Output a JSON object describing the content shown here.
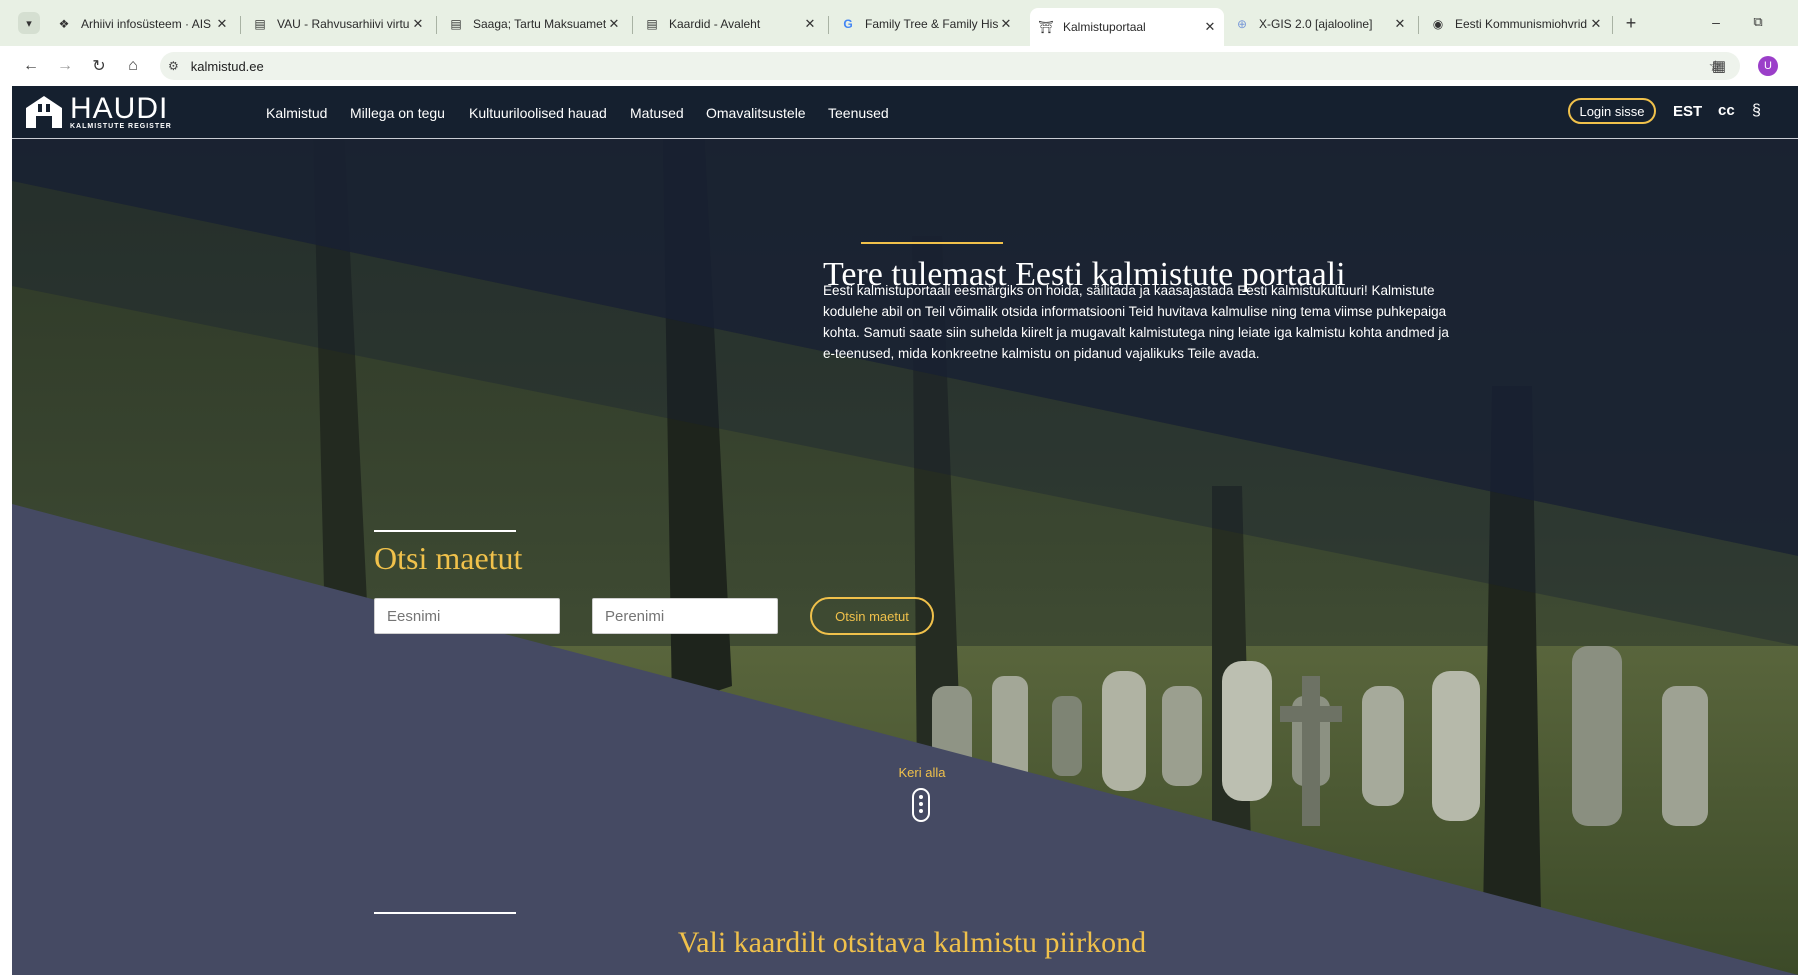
{
  "browser": {
    "tabs": [
      {
        "title": "Arhiivi infosüsteem · AIS",
        "icon": "ais-icon"
      },
      {
        "title": "VAU - Rahvusarhiivi virtua",
        "icon": "document-icon"
      },
      {
        "title": "Saaga; Tartu Maksuamet",
        "icon": "document-icon"
      },
      {
        "title": "Kaardid - Avaleht",
        "icon": "document-icon"
      },
      {
        "title": "Family Tree & Family Hist",
        "icon": "google-icon"
      },
      {
        "title": "Kalmistuportaal",
        "icon": "haudi-icon"
      },
      {
        "title": "X-GIS 2.0 [ajalooline]",
        "icon": "globe-icon"
      },
      {
        "title": "Eesti Kommunismiohvrid",
        "icon": "globe-icon"
      }
    ],
    "url": "kalmistud.ee",
    "profile_initial": "U"
  },
  "site": {
    "logo_text": "HAUDI",
    "logo_subtitle": "KALMISTUTE REGISTER",
    "menu": [
      "Kalmistud",
      "Millega on tegu",
      "Kultuuriloolised hauad",
      "Matused",
      "Omavalitsustele",
      "Teenused"
    ],
    "login_label": "Login sisse",
    "language": "EST",
    "accessibility_icon": "glasses-icon",
    "section_symbol": "§"
  },
  "hero": {
    "title": "Tere tulemast Eesti kalmistute portaali",
    "description": "Eesti kalmistuportaali eesmärgiks on hoida, säilitada ja kaasajastada Eesti kalmistukultuuri! Kalmistute kodulehe abil on Teil võimalik otsida informatsiooni Teid huvitava kalmulise ning tema viimse puhkepaiga kohta. Samuti saate siin suhelda kiirelt ja mugavalt kalmistutega ning leiate iga kalmistu kohta andmed ja e-teenused, mida konkreetne kalmistu on pidanud vajalikuks Teile avada."
  },
  "search": {
    "title": "Otsi maetut",
    "first_name_placeholder": "Eesnimi",
    "last_name_placeholder": "Perenimi",
    "button_label": "Otsin maetut"
  },
  "scroll": {
    "label": "Keri alla"
  },
  "map_section": {
    "title": "Vali kaardilt otsitava kalmistu piirkond"
  },
  "colors": {
    "accent": "#f0c14b",
    "header": "#15202f",
    "slate": "#454a63"
  }
}
